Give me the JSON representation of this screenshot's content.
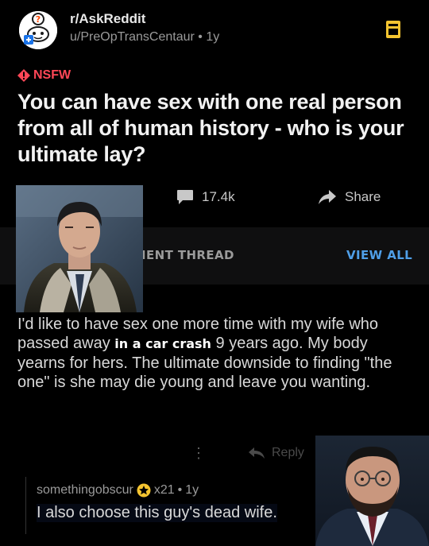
{
  "header": {
    "subreddit": "r/AskReddit",
    "author": "u/PreOpTransCentaur",
    "separator": "•",
    "age": "1y"
  },
  "post": {
    "nsfw_label": "NSFW",
    "title": "You can have sex with one real person from all of human history - who is your ultimate lay?"
  },
  "actions": {
    "comment_count": "17.4k",
    "share_label": "Share"
  },
  "thread": {
    "label": "IENT THREAD",
    "view_all": "VIEW ALL"
  },
  "comment": {
    "text_before": "I'd like to have sex one more time with my wife who passed away ",
    "overlay": "in a  car crash ",
    "text_after": "9 years ago. My body yearns for hers. The ultimate downside to finding \"the one\" is she may die young and leave you wanting.",
    "more": "⋮",
    "reply_label": "Reply"
  },
  "nested_reply": {
    "username": "somethingobscur",
    "award_count": "x21",
    "separator": "•",
    "age": "1y",
    "text": "I also choose this guy's dead wife."
  },
  "icons": {
    "avatar": "askreddit-snoo-icon",
    "save": "bookmark-icon",
    "nsfw": "warning-diamond-icon",
    "comments": "comment-bubble-icon",
    "share": "share-arrow-icon",
    "reply": "reply-arrow-icon",
    "award": "award-icon"
  },
  "colors": {
    "background": "#000000",
    "nsfw": "#ff4757",
    "link": "#4f9fe8",
    "save_icon": "#f4c430"
  }
}
